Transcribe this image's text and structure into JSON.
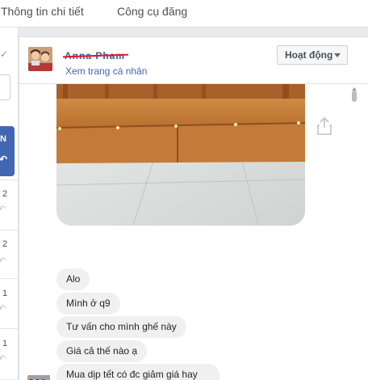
{
  "topnav": {
    "tabs": [
      "Thông tin chi tiết",
      "Công cụ đăng"
    ]
  },
  "leftcol": {
    "button_label": "N",
    "counts": [
      "2",
      "2",
      "1",
      "1"
    ]
  },
  "header": {
    "user_name": "Anna Pham",
    "profile_link": "Xem trang cá nhân",
    "status_label": "Hoạt động"
  },
  "messages": [
    "Alo",
    "Mình ở q9",
    "Tư vấn cho mình ghế này",
    "Giá cả thế nào ạ",
    "Mua dịp tết có đc giảm giá hay tặng quà ko ạ"
  ],
  "colors": {
    "accent": "#4267b2",
    "bubble": "#f1f0f0",
    "redaction": "#e0162b"
  },
  "icons": [
    "check-icon",
    "reply-icon",
    "share-icon",
    "dropdown-caret-icon",
    "scroll-up-arrow-icon"
  ]
}
